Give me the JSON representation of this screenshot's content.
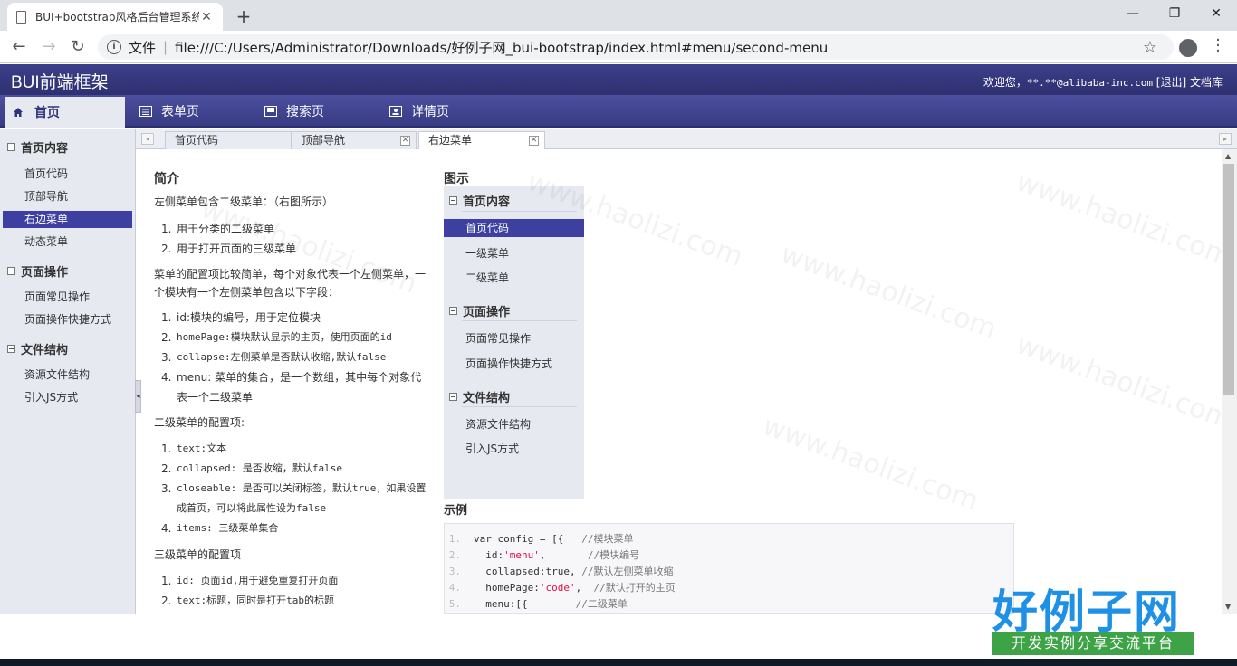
{
  "browser": {
    "tab_title": "BUI+bootstrap风格后台管理系统",
    "new_tab": "+",
    "url_label": "文件",
    "url": "file:///C:/Users/Administrator/Downloads/好例子网_bui-bootstrap/index.html#menu/second-menu"
  },
  "header": {
    "brand": "BUI前端框架",
    "welcome": "欢迎您，",
    "user": "**.**@alibaba-inc.com",
    "logout": "[退出]",
    "docs": "文档库"
  },
  "nav": [
    {
      "label": "首页",
      "icon": "home-icon",
      "active": true
    },
    {
      "label": "表单页",
      "icon": "form-icon"
    },
    {
      "label": "搜索页",
      "icon": "search-page-icon"
    },
    {
      "label": "详情页",
      "icon": "detail-icon"
    }
  ],
  "sidebar": {
    "groups": [
      {
        "title": "首页内容",
        "items": [
          "首页代码",
          "顶部导航",
          "右边菜单",
          "动态菜单"
        ]
      },
      {
        "title": "页面操作",
        "items": [
          "页面常见操作",
          "页面操作快捷方式"
        ]
      },
      {
        "title": "文件结构",
        "items": [
          "资源文件结构",
          "引入JS方式"
        ]
      }
    ],
    "selected": "右边菜单"
  },
  "tabs": [
    {
      "label": "首页代码"
    },
    {
      "label": "顶部导航",
      "closable": true
    },
    {
      "label": "右边菜单",
      "closable": true,
      "active": true
    }
  ],
  "intro": {
    "title": "简介",
    "p1": "左侧菜单包含二级菜单：（右图所示）",
    "list1": [
      "用于分类的二级菜单",
      "用于打开页面的三级菜单"
    ],
    "p2": "菜单的配置项比较简单，每个对象代表一个左侧菜单，一个模块有一个左侧菜单包含以下字段：",
    "list2": [
      "id:模块的编号，用于定位模块",
      "homePage:模块默认显示的主页，使用页面的id",
      "collapse:左侧菜单是否默认收缩,默认false",
      "menu: 菜单的集合，是一个数组，其中每个对象代表一个二级菜单"
    ],
    "p3": "二级菜单的配置项:",
    "list3": [
      "text:文本",
      "collapsed: 是否收缩，默认false",
      "closeable: 是否可以关闭标签，默认true，如果设置成首页，可以将此属性设为false",
      "items: 三级菜单集合"
    ],
    "p4": "三级菜单的配置项",
    "list4": [
      "id: 页面id,用于避免重复打开页面",
      "text:标题，同时是打开tab的标题"
    ]
  },
  "figure": {
    "title": "图示",
    "groups": [
      {
        "title": "首页内容",
        "items": [
          "首页代码",
          "一级菜单",
          "二级菜单"
        ]
      },
      {
        "title": "页面操作",
        "items": [
          "页面常见操作",
          "页面操作快捷方式"
        ]
      },
      {
        "title": "文件结构",
        "items": [
          "资源文件结构",
          "引入JS方式"
        ]
      }
    ],
    "selected": "首页代码"
  },
  "example": {
    "title": "示例",
    "lines": [
      {
        "n": "1.",
        "code": "var config = [{",
        "comment": "//模块菜单"
      },
      {
        "n": "2.",
        "code": "  id:",
        "str": "'menu'",
        "after": ",",
        "comment": "//模块编号"
      },
      {
        "n": "3.",
        "code": "  collapsed:true,",
        "comment": "//默认左侧菜单收缩"
      },
      {
        "n": "4.",
        "code": "  homePage:",
        "str": "'code'",
        "after": ",",
        "comment": "//默认打开的主页"
      },
      {
        "n": "5.",
        "code": "  menu:[{",
        "comment": "//二级菜单"
      }
    ]
  },
  "watermark": {
    "logo_title": "好例子网",
    "logo_sub": "开发实例分享交流平台",
    "text": "www.haolizi.com"
  }
}
